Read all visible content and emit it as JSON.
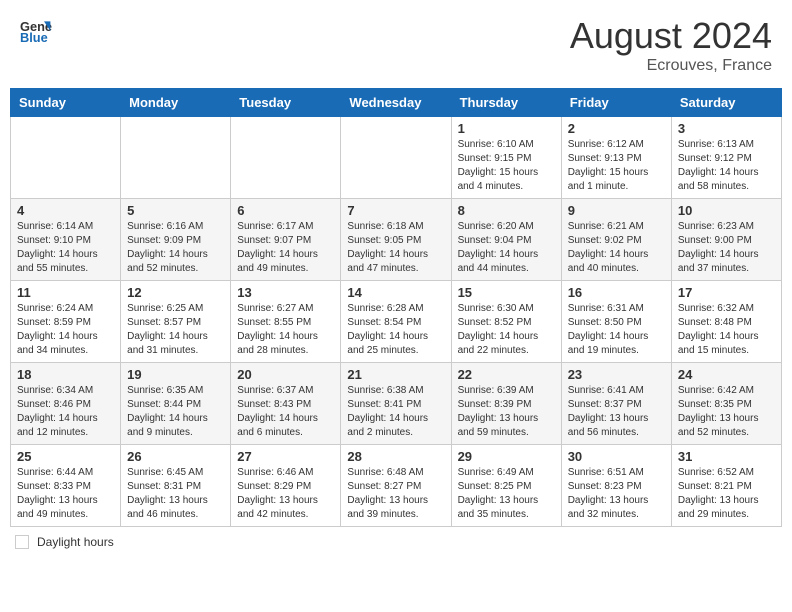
{
  "header": {
    "logo_line1": "General",
    "logo_line2": "Blue",
    "month_title": "August 2024",
    "location": "Ecrouves, France"
  },
  "days_of_week": [
    "Sunday",
    "Monday",
    "Tuesday",
    "Wednesday",
    "Thursday",
    "Friday",
    "Saturday"
  ],
  "weeks": [
    [
      {
        "day": "",
        "info": ""
      },
      {
        "day": "",
        "info": ""
      },
      {
        "day": "",
        "info": ""
      },
      {
        "day": "",
        "info": ""
      },
      {
        "day": "1",
        "info": "Sunrise: 6:10 AM\nSunset: 9:15 PM\nDaylight: 15 hours\nand 4 minutes."
      },
      {
        "day": "2",
        "info": "Sunrise: 6:12 AM\nSunset: 9:13 PM\nDaylight: 15 hours\nand 1 minute."
      },
      {
        "day": "3",
        "info": "Sunrise: 6:13 AM\nSunset: 9:12 PM\nDaylight: 14 hours\nand 58 minutes."
      }
    ],
    [
      {
        "day": "4",
        "info": "Sunrise: 6:14 AM\nSunset: 9:10 PM\nDaylight: 14 hours\nand 55 minutes."
      },
      {
        "day": "5",
        "info": "Sunrise: 6:16 AM\nSunset: 9:09 PM\nDaylight: 14 hours\nand 52 minutes."
      },
      {
        "day": "6",
        "info": "Sunrise: 6:17 AM\nSunset: 9:07 PM\nDaylight: 14 hours\nand 49 minutes."
      },
      {
        "day": "7",
        "info": "Sunrise: 6:18 AM\nSunset: 9:05 PM\nDaylight: 14 hours\nand 47 minutes."
      },
      {
        "day": "8",
        "info": "Sunrise: 6:20 AM\nSunset: 9:04 PM\nDaylight: 14 hours\nand 44 minutes."
      },
      {
        "day": "9",
        "info": "Sunrise: 6:21 AM\nSunset: 9:02 PM\nDaylight: 14 hours\nand 40 minutes."
      },
      {
        "day": "10",
        "info": "Sunrise: 6:23 AM\nSunset: 9:00 PM\nDaylight: 14 hours\nand 37 minutes."
      }
    ],
    [
      {
        "day": "11",
        "info": "Sunrise: 6:24 AM\nSunset: 8:59 PM\nDaylight: 14 hours\nand 34 minutes."
      },
      {
        "day": "12",
        "info": "Sunrise: 6:25 AM\nSunset: 8:57 PM\nDaylight: 14 hours\nand 31 minutes."
      },
      {
        "day": "13",
        "info": "Sunrise: 6:27 AM\nSunset: 8:55 PM\nDaylight: 14 hours\nand 28 minutes."
      },
      {
        "day": "14",
        "info": "Sunrise: 6:28 AM\nSunset: 8:54 PM\nDaylight: 14 hours\nand 25 minutes."
      },
      {
        "day": "15",
        "info": "Sunrise: 6:30 AM\nSunset: 8:52 PM\nDaylight: 14 hours\nand 22 minutes."
      },
      {
        "day": "16",
        "info": "Sunrise: 6:31 AM\nSunset: 8:50 PM\nDaylight: 14 hours\nand 19 minutes."
      },
      {
        "day": "17",
        "info": "Sunrise: 6:32 AM\nSunset: 8:48 PM\nDaylight: 14 hours\nand 15 minutes."
      }
    ],
    [
      {
        "day": "18",
        "info": "Sunrise: 6:34 AM\nSunset: 8:46 PM\nDaylight: 14 hours\nand 12 minutes."
      },
      {
        "day": "19",
        "info": "Sunrise: 6:35 AM\nSunset: 8:44 PM\nDaylight: 14 hours\nand 9 minutes."
      },
      {
        "day": "20",
        "info": "Sunrise: 6:37 AM\nSunset: 8:43 PM\nDaylight: 14 hours\nand 6 minutes."
      },
      {
        "day": "21",
        "info": "Sunrise: 6:38 AM\nSunset: 8:41 PM\nDaylight: 14 hours\nand 2 minutes."
      },
      {
        "day": "22",
        "info": "Sunrise: 6:39 AM\nSunset: 8:39 PM\nDaylight: 13 hours\nand 59 minutes."
      },
      {
        "day": "23",
        "info": "Sunrise: 6:41 AM\nSunset: 8:37 PM\nDaylight: 13 hours\nand 56 minutes."
      },
      {
        "day": "24",
        "info": "Sunrise: 6:42 AM\nSunset: 8:35 PM\nDaylight: 13 hours\nand 52 minutes."
      }
    ],
    [
      {
        "day": "25",
        "info": "Sunrise: 6:44 AM\nSunset: 8:33 PM\nDaylight: 13 hours\nand 49 minutes."
      },
      {
        "day": "26",
        "info": "Sunrise: 6:45 AM\nSunset: 8:31 PM\nDaylight: 13 hours\nand 46 minutes."
      },
      {
        "day": "27",
        "info": "Sunrise: 6:46 AM\nSunset: 8:29 PM\nDaylight: 13 hours\nand 42 minutes."
      },
      {
        "day": "28",
        "info": "Sunrise: 6:48 AM\nSunset: 8:27 PM\nDaylight: 13 hours\nand 39 minutes."
      },
      {
        "day": "29",
        "info": "Sunrise: 6:49 AM\nSunset: 8:25 PM\nDaylight: 13 hours\nand 35 minutes."
      },
      {
        "day": "30",
        "info": "Sunrise: 6:51 AM\nSunset: 8:23 PM\nDaylight: 13 hours\nand 32 minutes."
      },
      {
        "day": "31",
        "info": "Sunrise: 6:52 AM\nSunset: 8:21 PM\nDaylight: 13 hours\nand 29 minutes."
      }
    ]
  ],
  "footer": {
    "legend_label": "Daylight hours"
  }
}
